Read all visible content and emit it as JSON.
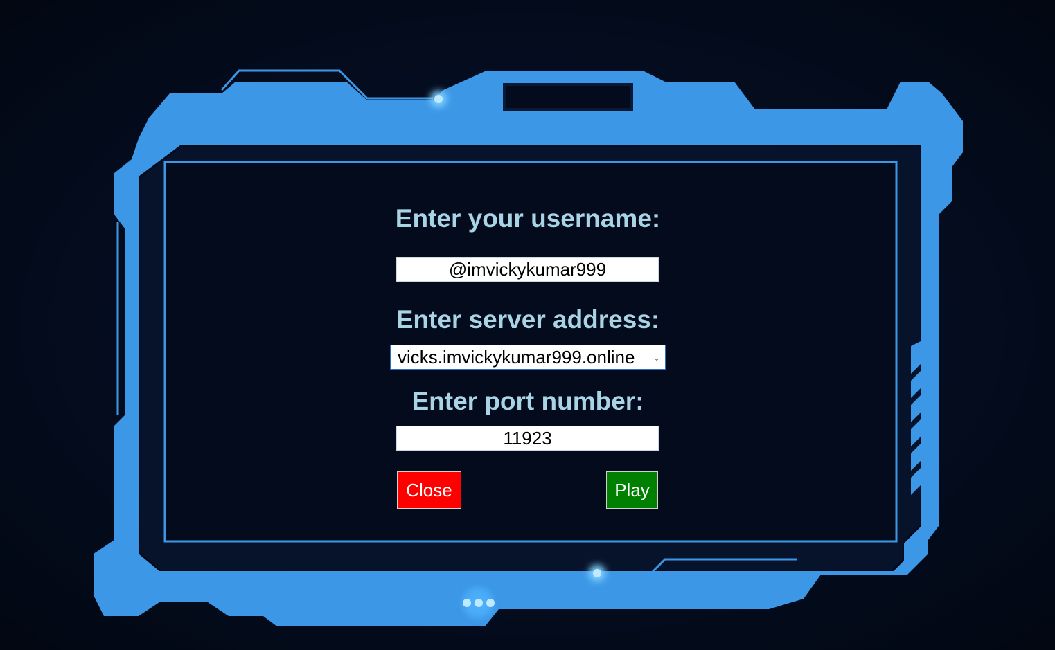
{
  "colors": {
    "background": "#030a18",
    "frame": "#3c97e6",
    "frame_glow": "#7fd0ff",
    "label": "#a9d4e6",
    "close_button": "#ff0000",
    "play_button": "#008000"
  },
  "form": {
    "username_label": "Enter your username:",
    "username_value": "@imvickykumar999",
    "server_label": "Enter server address:",
    "server_value": "vicks.imvickykumar999.online",
    "server_dropdown_icon": "chevron-down-icon",
    "port_label": "Enter port number:",
    "port_value": "11923"
  },
  "buttons": {
    "close_label": "Close",
    "play_label": "Play"
  }
}
